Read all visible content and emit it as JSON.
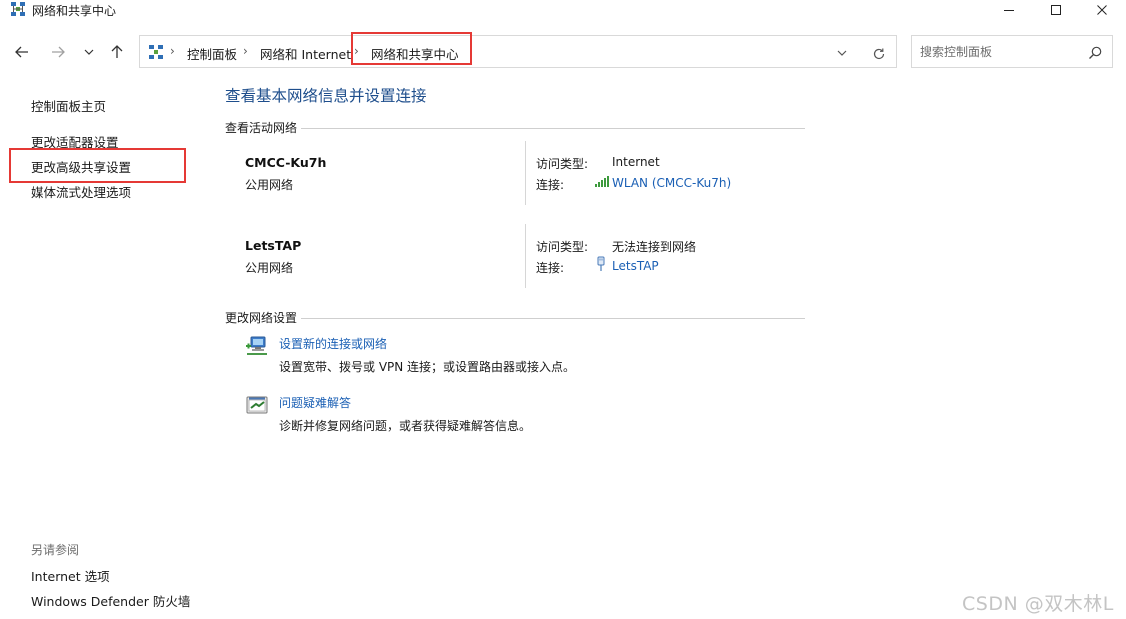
{
  "window": {
    "title": "网络和共享中心"
  },
  "address": {
    "breadcrumbs": [
      "控制面板",
      "网络和 Internet",
      "网络和共享中心"
    ]
  },
  "search": {
    "placeholder": "搜索控制面板"
  },
  "left_nav": {
    "items": [
      "控制面板主页",
      "更改适配器设置",
      "更改高级共享设置",
      "媒体流式处理选项"
    ],
    "see_also_title": "另请参阅",
    "see_also": [
      "Internet 选项",
      "Windows Defender 防火墙"
    ]
  },
  "main": {
    "title": "查看基本网络信息并设置连接",
    "active_section": "查看活动网络",
    "networks": [
      {
        "name": "CMCC-Ku7h",
        "type": "公用网络",
        "access_label": "访问类型:",
        "access_value": "Internet",
        "conn_label": "连接:",
        "conn_value": "WLAN (CMCC-Ku7h)",
        "conn_icon": "wifi-signal-icon"
      },
      {
        "name": "LetsTAP",
        "type": "公用网络",
        "access_label": "访问类型:",
        "access_value": "无法连接到网络",
        "conn_label": "连接:",
        "conn_value": "LetsTAP",
        "conn_icon": "ethernet-plug-icon"
      }
    ],
    "change_section": "更改网络设置",
    "tasks": [
      {
        "title": "设置新的连接或网络",
        "desc": "设置宽带、拨号或 VPN 连接；或设置路由器或接入点。",
        "icon": "new-connection-icon"
      },
      {
        "title": "问题疑难解答",
        "desc": "诊断并修复网络问题，或者获得疑难解答信息。",
        "icon": "troubleshoot-icon"
      }
    ]
  },
  "watermark": "CSDN @双木林L",
  "colors": {
    "link": "#1a5fb4",
    "heading": "#1e4e8c",
    "highlight": "#e53935"
  }
}
